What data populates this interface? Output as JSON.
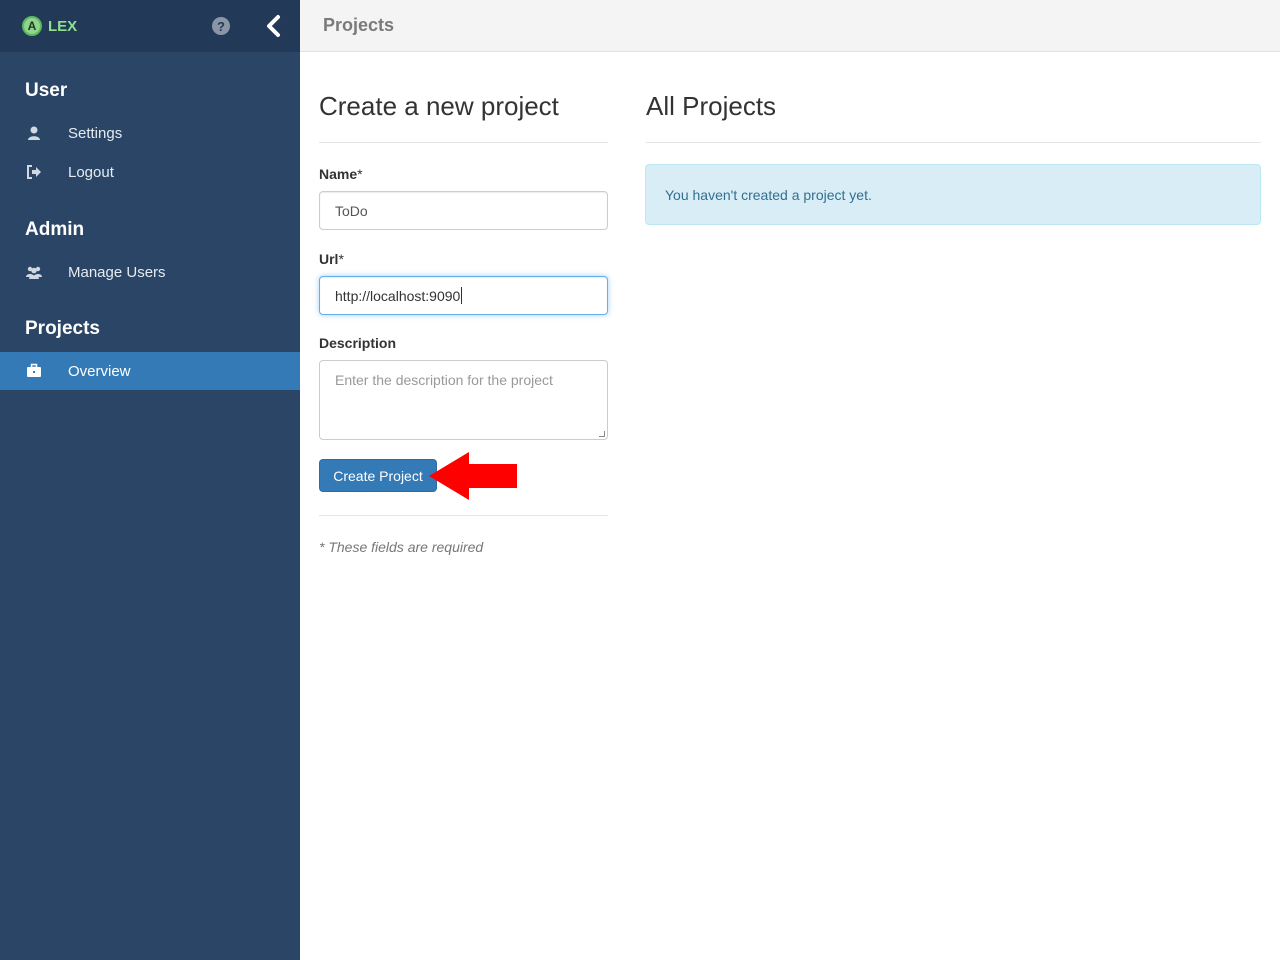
{
  "app": {
    "logo_letter": "A",
    "logo_text": "LEX"
  },
  "topbar": {
    "title": "Projects"
  },
  "sidebar": {
    "sections": [
      {
        "title": "User",
        "items": [
          {
            "label": "Settings",
            "icon": "user-icon"
          },
          {
            "label": "Logout",
            "icon": "sign-out-icon"
          }
        ]
      },
      {
        "title": "Admin",
        "items": [
          {
            "label": "Manage Users",
            "icon": "users-icon"
          }
        ]
      },
      {
        "title": "Projects",
        "items": [
          {
            "label": "Overview",
            "icon": "briefcase-icon",
            "active": true
          }
        ]
      }
    ]
  },
  "create_form": {
    "heading": "Create a new project",
    "name_label": "Name",
    "name_required": "*",
    "name_value": "ToDo",
    "url_label": "Url",
    "url_required": "*",
    "url_value": "http://localhost:9090",
    "description_label": "Description",
    "description_placeholder": "Enter the description for the project",
    "submit_label": "Create Project",
    "required_note": "* These fields are required"
  },
  "all_projects": {
    "heading": "All Projects",
    "empty_message": "You haven't created a project yet."
  },
  "colors": {
    "sidebar_bg": "#2a4566",
    "accent": "#337ab7",
    "alert_bg": "#d9edf7",
    "arrow": "#ff0000"
  }
}
